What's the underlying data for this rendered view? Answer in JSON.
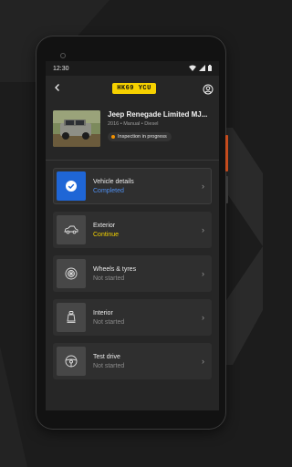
{
  "status_bar": {
    "time": "12:30",
    "wifi_icon": "wifi-icon",
    "signal_icon": "signal-icon",
    "battery_icon": "battery-icon"
  },
  "app_bar": {
    "back_icon": "back-arrow-icon",
    "plate": "HK69 YCU",
    "profile_icon": "profile-icon"
  },
  "vehicle": {
    "title": "Jeep Renegade Limited MJ...",
    "subtitle": "2016 • Manual • Diesel",
    "status": "Inspection in progress",
    "status_color": "#f29100"
  },
  "steps": [
    {
      "title": "Vehicle details",
      "status": "Completed",
      "icon": "check-icon"
    },
    {
      "title": "Exterior",
      "status": "Continue",
      "icon": "car-icon"
    },
    {
      "title": "Wheels & tyres",
      "status": "Not started",
      "icon": "wheel-icon"
    },
    {
      "title": "Interior",
      "status": "Not started",
      "icon": "seat-icon"
    },
    {
      "title": "Test drive",
      "status": "Not started",
      "icon": "steering-wheel-icon"
    }
  ],
  "colors": {
    "plate": "#f6d100",
    "completed": "#4f8ff0",
    "continue": "#f2d100",
    "accent_side": "#c44b1d"
  }
}
